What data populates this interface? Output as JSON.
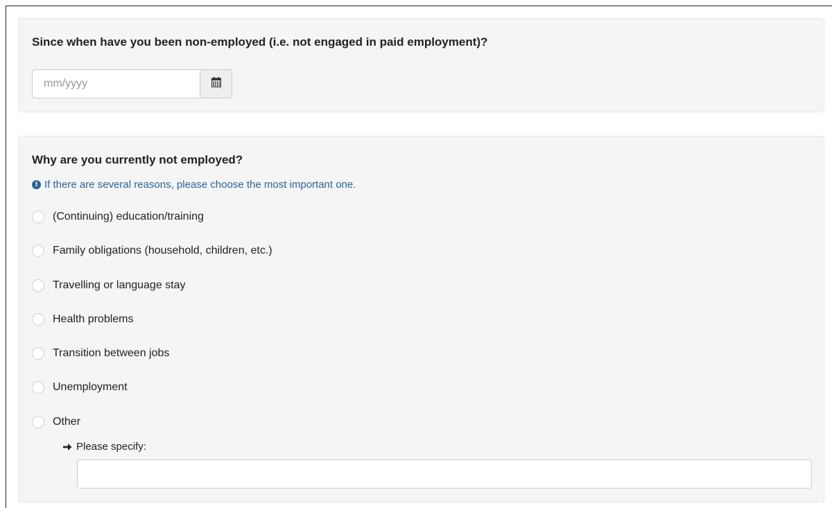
{
  "q1": {
    "title": "Since when have you been non-employed (i.e. not engaged in paid employment)?",
    "date_placeholder": "mm/yyyy",
    "date_value": "",
    "calendar_icon": "calendar-icon"
  },
  "q2": {
    "title": "Why are you currently not employed?",
    "hint": "If there are several reasons, please choose the most important one.",
    "hint_icon": "exclamation-circle-icon",
    "options": [
      {
        "label": "(Continuing) education/training",
        "selected": false
      },
      {
        "label": "Family obligations (household, children, etc.)",
        "selected": false
      },
      {
        "label": "Travelling or language stay",
        "selected": false
      },
      {
        "label": "Health problems",
        "selected": false
      },
      {
        "label": "Transition between jobs",
        "selected": false
      },
      {
        "label": "Unemployment",
        "selected": false
      },
      {
        "label": "Other",
        "selected": false
      }
    ],
    "specify_label": "Please specify:",
    "specify_icon": "arrow-right-icon",
    "specify_value": ""
  },
  "colors": {
    "panel_bg": "#f5f5f5",
    "hint_text": "#2a6496",
    "border": "#cccccc"
  }
}
